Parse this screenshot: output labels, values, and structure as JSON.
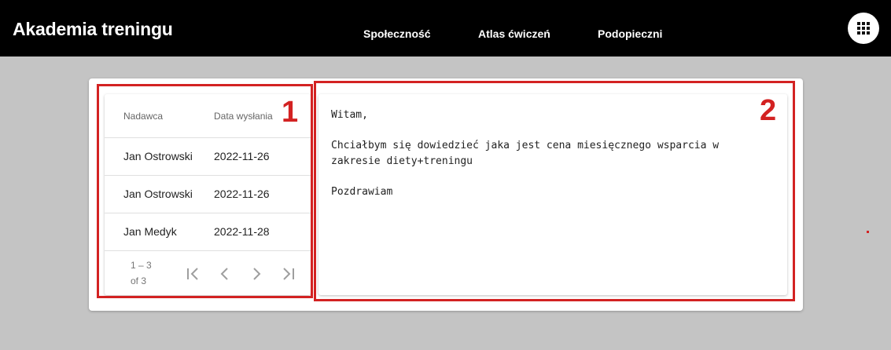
{
  "header": {
    "brand": "Akademia treningu",
    "nav": [
      "Społeczność",
      "Atlas ćwiczeń",
      "Podopieczni"
    ],
    "apps_icon": "grid-apps-icon"
  },
  "table": {
    "columns": [
      "Nadawca",
      "Data wysłania"
    ],
    "rows": [
      {
        "sender": "Jan Ostrowski",
        "date": "2022-11-26"
      },
      {
        "sender": "Jan Ostrowski",
        "date": "2022-11-26"
      },
      {
        "sender": "Jan Medyk",
        "date": "2022-11-28"
      }
    ],
    "pager": {
      "range": "1 – 3",
      "of": "of 3"
    }
  },
  "message": {
    "lines": [
      "Witam,",
      "Chciałbym się dowiedzieć jaka jest cena miesięcznego wsparcia w",
      "zakresie diety+treningu",
      "Pozdrawiam"
    ]
  },
  "annotations": {
    "one": "1",
    "two": "2",
    "color": "#d32222"
  }
}
